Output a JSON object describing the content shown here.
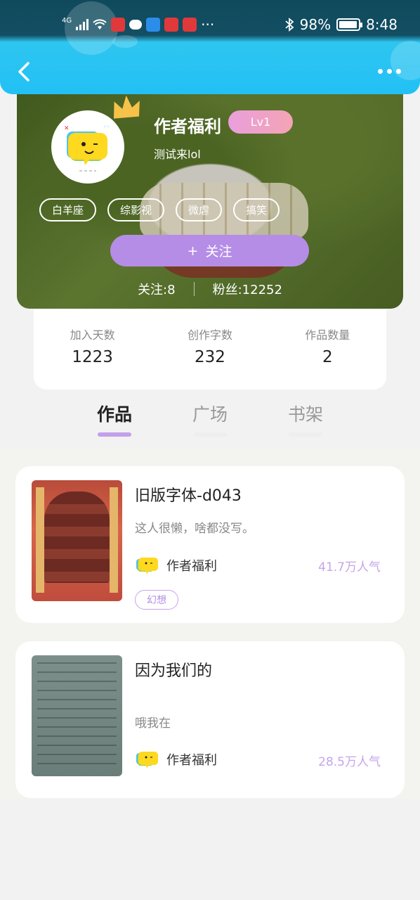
{
  "status_bar": {
    "network": "4G",
    "battery": "98%",
    "time": "8:48",
    "more": "···"
  },
  "header": {
    "back_icon": "chevron-left-icon",
    "more_icon": "ellipsis-icon"
  },
  "profile": {
    "name": "作者福利",
    "level": "Lv1",
    "signature": "测试来lol",
    "tags": [
      "白羊座",
      "综影视",
      "微虐",
      "搞笑"
    ],
    "follow_button": "关注",
    "follow_prefix": "+",
    "following_label": "关注:",
    "following_count": "8",
    "followers_label": "粉丝:",
    "followers_count": "12252"
  },
  "stats": [
    {
      "label": "加入天数",
      "value": "1223"
    },
    {
      "label": "创作字数",
      "value": "232"
    },
    {
      "label": "作品数量",
      "value": "2"
    }
  ],
  "tabs": [
    {
      "label": "作品",
      "active": true
    },
    {
      "label": "广场",
      "active": false
    },
    {
      "label": "书架",
      "active": false
    }
  ],
  "works": [
    {
      "title": "旧版字体-d043",
      "description": "这人很懒，啥都没写。",
      "author": "作者福利",
      "popularity": "41.7万人气",
      "genre": "幻想"
    },
    {
      "title": "因为我们的",
      "description": "哦我在",
      "author": "作者福利",
      "popularity": "28.5万人气",
      "genre": ""
    }
  ],
  "colors": {
    "accent": "#b58de6",
    "header": "#22c0f5",
    "popularity": "#c7a4ea"
  }
}
